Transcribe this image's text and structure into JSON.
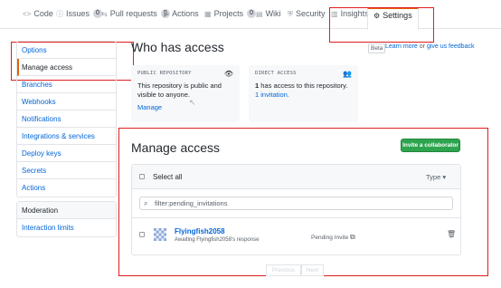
{
  "tabs": [
    {
      "icon": "<>",
      "label": "Code",
      "count": ""
    },
    {
      "icon": "ⓘ",
      "label": "Issues",
      "count": "0"
    },
    {
      "icon": "⇆",
      "label": "Pull requests",
      "count": "0"
    },
    {
      "icon": "▶",
      "label": "Actions",
      "count": ""
    },
    {
      "icon": "▦",
      "label": "Projects",
      "count": "0"
    },
    {
      "icon": "▤",
      "label": "Wiki",
      "count": ""
    },
    {
      "icon": "⛨",
      "label": "Security",
      "count": ""
    },
    {
      "icon": "▥",
      "label": "Insights",
      "count": ""
    },
    {
      "icon": "⚙",
      "label": "Settings",
      "count": ""
    }
  ],
  "sidebar": {
    "items": [
      "Options",
      "Manage access",
      "Branches",
      "Webhooks",
      "Notifications",
      "Integrations & services",
      "Deploy keys",
      "Secrets",
      "Actions"
    ],
    "moderation_header": "Moderation",
    "moderation_items": [
      "Interaction limits"
    ]
  },
  "who": {
    "title": "Who has access",
    "beta": "Beta",
    "learn_more": "Learn more",
    "or": "or",
    "feedback": "give us feedback",
    "public_label": "PUBLIC REPOSITORY",
    "public_text": "This repository is public and visible to anyone.",
    "manage_link": "Manage",
    "direct_label": "DIRECT ACCESS",
    "direct_count": "1",
    "direct_text": "has access to this repository.",
    "direct_link": "1 invitation."
  },
  "manage": {
    "title": "Manage access",
    "invite_button": "Invite a collaborator",
    "select_all": "Select all",
    "type_label": "Type ▾",
    "filter_value": "filter:pending_invitations",
    "row": {
      "username": "Flyingfish2058",
      "subtext": "Awaiting Flyingfish2058's response",
      "status": "Pending Invite"
    },
    "previous": "Previous",
    "next": "Next"
  }
}
